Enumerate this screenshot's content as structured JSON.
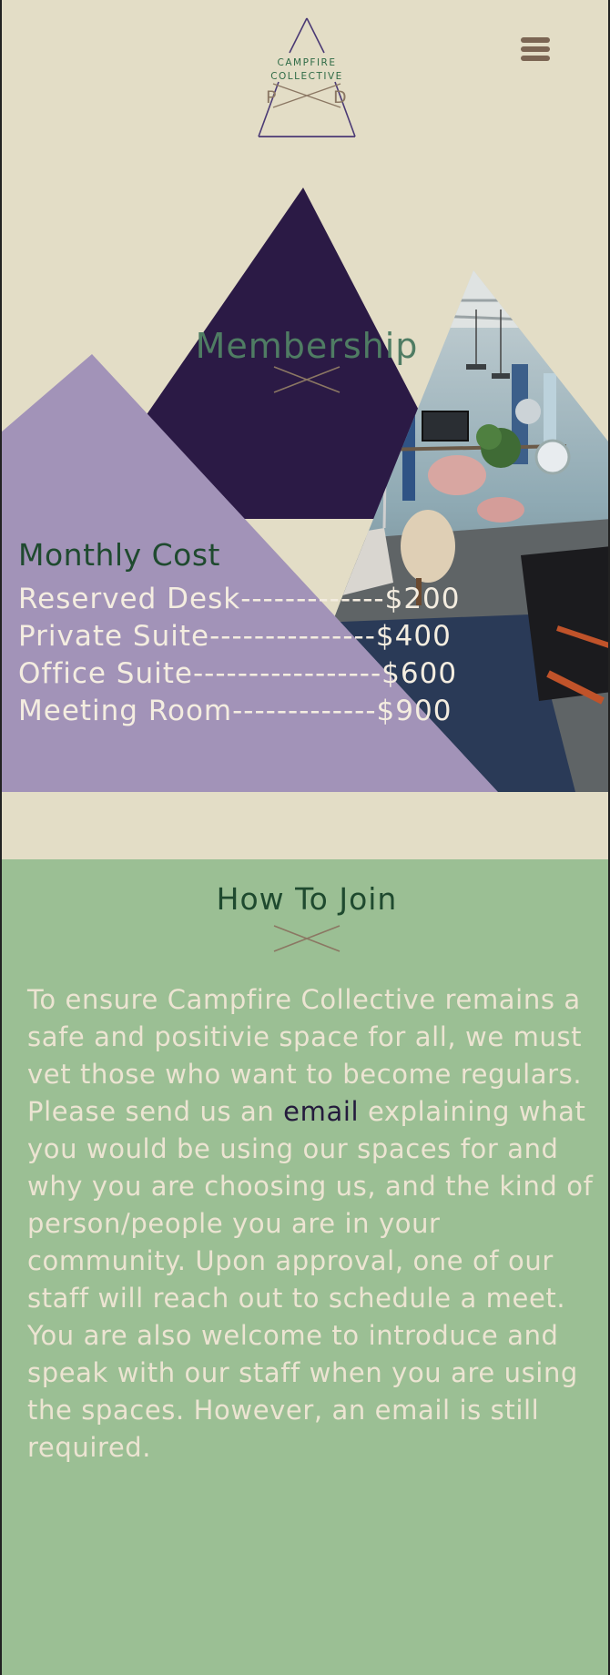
{
  "brand": {
    "name_line1": "CAMPFIRE",
    "name_line2": "COLLECTIVE",
    "initial_left": "P",
    "initial_right": "D",
    "logo_icon": "triangle-logo-icon"
  },
  "header": {
    "menu_icon": "hamburger-menu-icon"
  },
  "membership": {
    "title": "Membership",
    "cost_heading": "Monthly Cost",
    "prices": [
      {
        "label": "Reserved Desk",
        "dashes": "-------------",
        "price": "$200"
      },
      {
        "label": "Private Suite",
        "dashes": "---------------",
        "price": "$400"
      },
      {
        "label": "Office Suite",
        "dashes": "-----------------",
        "price": "$600"
      },
      {
        "label": "Meeting Room",
        "dashes": "-------------",
        "price": "$900"
      }
    ],
    "photo_description_icon": "coworking-space-photo"
  },
  "join": {
    "title": "How To Join",
    "text_before_link": "To ensure Campfire Collective remains a safe and positivie space for all, we must vet those who want to become regulars. Please send us an ",
    "link_text": "email",
    "text_after_link": " explaining what you would be using our spaces for and why you are choosing us, and the kind of person/people you are in your community. Upon approval, one of our staff will reach out to schedule a meet. You are also welcome to introduce and speak with our staff when you are using the spaces. However, an email is still required."
  },
  "colors": {
    "background": "#e3ddc6",
    "dark_purple": "#2b1a45",
    "light_purple": "#a293b8",
    "green_section": "#9bbf94",
    "title_green": "#1f4a2f",
    "accent_brown": "#8b7763"
  }
}
